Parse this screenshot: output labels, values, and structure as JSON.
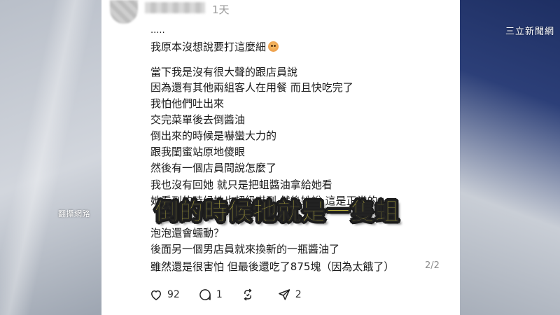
{
  "background": {
    "watermark_left": "翻攝網路",
    "channel_logo": "三立新聞網"
  },
  "post": {
    "time": "1天",
    "ellipsis": ".....",
    "lines": [
      "我原本沒想說要打這麼細",
      "當下我是沒有很大聲的跟店員說",
      "因為還有其他兩組客人在用餐 而且快吃完了",
      "我怕他們吐出來",
      "交完菜單後去倒醬油",
      "倒出來的時候是嚇蠻大力的",
      "跟我閨蜜站原地傻眼",
      "然後有一個店員問說怎麼了",
      "我也沒有回她 就只是把蛆醬油拿給她看",
      "她看到的時候她也超級嚇到 然後她說 這是正常的",
      "泡泡還會蠕動？",
      "後面另一個男店員就來換新的一瓶醬油了",
      "雖然還是很害怕 但最後還吃了875塊（因為太餓了）"
    ],
    "page_counter": "2/2",
    "actions": {
      "likes": "92",
      "comments": "1",
      "reposts": "",
      "shares": "2"
    }
  },
  "caption": "倒的時候牠就是一隻蛆",
  "colors": {
    "caption_fill": "#f7e94a",
    "caption_outline": "#1b1b1b",
    "card_bg": "#ffffff",
    "text": "#1a1a1a",
    "muted": "#9a9a9a"
  }
}
